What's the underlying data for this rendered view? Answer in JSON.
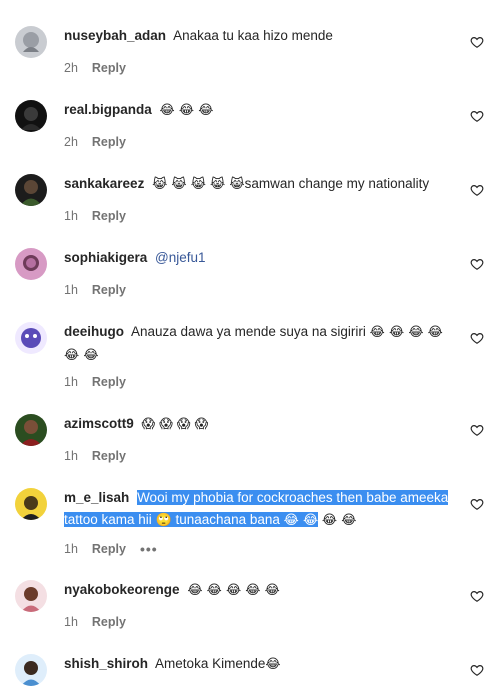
{
  "comments": [
    {
      "username": "nuseybah_adan",
      "text": "Anakaa tu kaa hizo mende",
      "time": "2h",
      "reply": "Reply",
      "avatar_color": "#9a9ea5"
    },
    {
      "username": "real.bigpanda",
      "text": "",
      "emojis": "😂 😂 😂",
      "time": "2h",
      "reply": "Reply",
      "avatar_color": "#1f1f1f"
    },
    {
      "username": "sankakareez",
      "emojis": "😹 😹 😹 😹 😹",
      "text": "samwan change my nationality",
      "time": "1h",
      "reply": "Reply",
      "avatar_color": "#2e2e2e"
    },
    {
      "username": "sophiakigera",
      "mention": "@njefu1",
      "time": "1h",
      "reply": "Reply",
      "avatar_color": "#b56fa0"
    },
    {
      "username": "deeihugo",
      "text": "Anauza dawa ya mende suya na sigiriri",
      "emojis_line1": "😂 😂 😂 😂",
      "emojis_line2": "😂 😂",
      "time": "1h",
      "reply": "Reply",
      "avatar_color": "#5a4bb8"
    },
    {
      "username": "azimscott9",
      "emojis": "😱 😱 😱 😱",
      "time": "1h",
      "reply": "Reply",
      "avatar_color": "#3a6a2c"
    },
    {
      "username": "m_e_lisah",
      "text_line1": "Wooi my phobia for cockroaches then babe ameeka",
      "text_line2a": "tattoo kama hii",
      "emoji_roll": "🙄",
      "text_line2b": "tunaachana bana",
      "emojis_line2": "😂 😂",
      "emojis_tail": "😂 😂",
      "time": "1h",
      "reply": "Reply",
      "more": "•••",
      "avatar_color": "#d8b21a"
    },
    {
      "username": "nyakobokeorenge",
      "emojis": "😂 😂 😂 😂 😂",
      "time": "1h",
      "reply": "Reply",
      "avatar_color": "#c96b7a"
    },
    {
      "username": "shish_shiroh",
      "text": "Ametoka Kimende",
      "emojis": "😂",
      "avatar_color": "#4a8fd0"
    }
  ],
  "colors": {
    "highlight": "#3b8ef0",
    "meta_text": "#737373",
    "mention": "#385898"
  },
  "icons": {
    "like": "heart-outline-icon"
  }
}
